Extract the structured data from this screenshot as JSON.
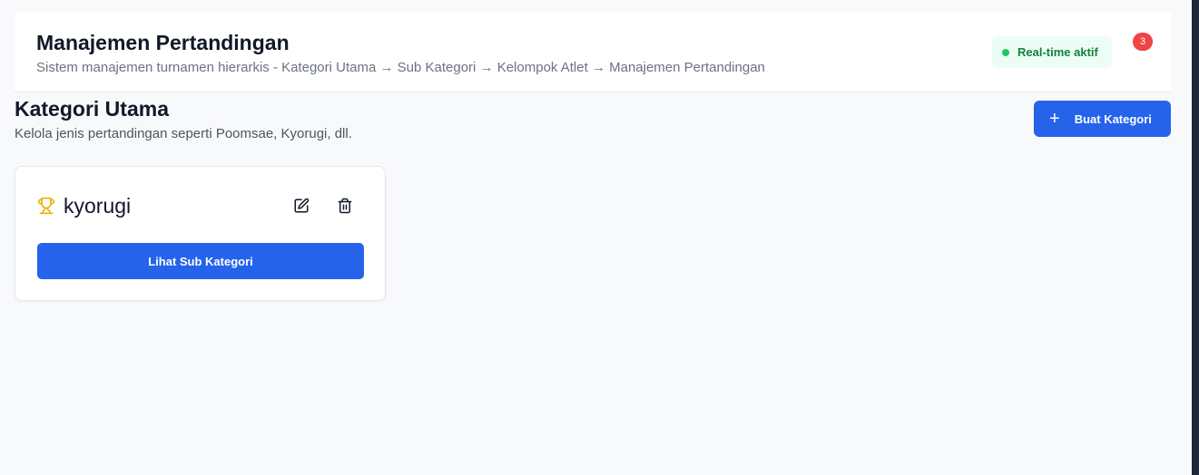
{
  "header": {
    "title": "Manajemen Pertandingan",
    "subtitle": "Sistem manajemen turnamen hierarkis - Kategori Utama → Sub Kategori → Kelompok Atlet → Manajemen Pertandingan",
    "realtime_label": "Real-time aktif",
    "notification_count": "3"
  },
  "section": {
    "title": "Kategori Utama",
    "subtitle": "Kelola jenis pertandingan seperti Poomsae, Kyorugi, dll.",
    "create_button_label": "Buat Kategori",
    "create_button_icon": "plus-icon"
  },
  "categories": [
    {
      "name": "kyorugi",
      "icon": "trophy-icon",
      "action_label": "Lihat Sub Kategori",
      "edit_icon": "edit-icon",
      "delete_icon": "trash-icon"
    }
  ],
  "colors": {
    "accent": "#2563eb",
    "success": "#22c55e",
    "success_text": "#15803d",
    "danger": "#ef4444",
    "trophy": "#eab308",
    "background": "#f8f9fb"
  }
}
